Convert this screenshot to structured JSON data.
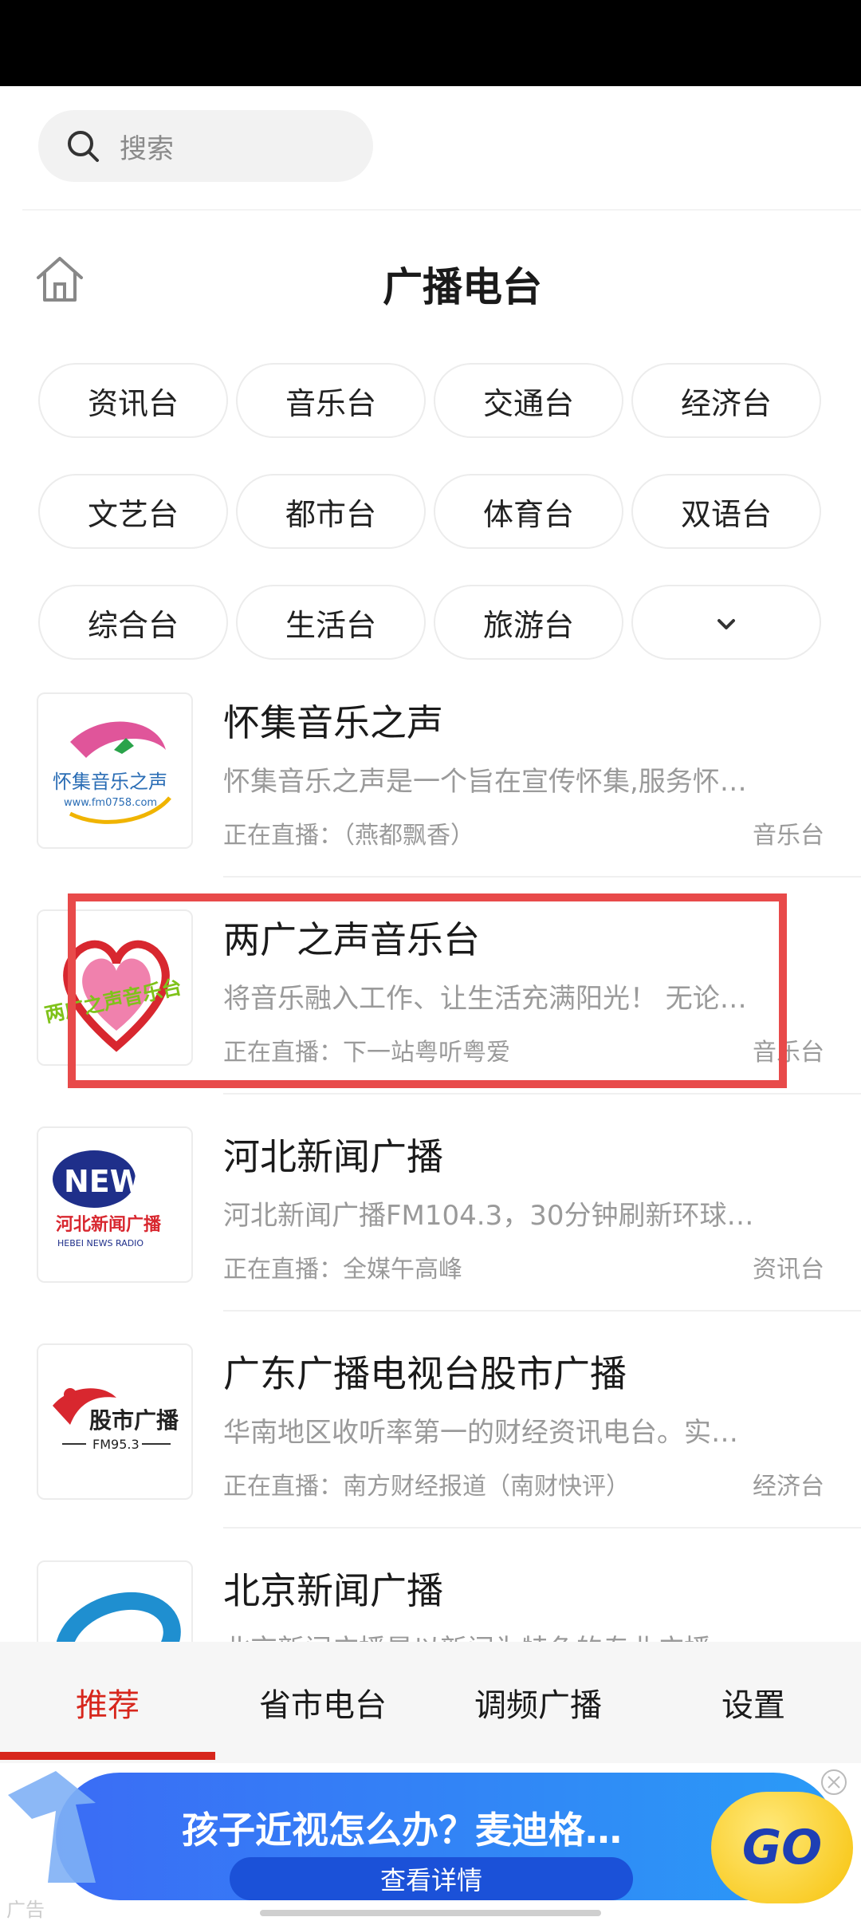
{
  "search": {
    "placeholder": "搜索",
    "icon": "search-icon"
  },
  "header": {
    "title": "广播电台",
    "home_icon": "home-icon"
  },
  "categories": [
    "资讯台",
    "音乐台",
    "交通台",
    "经济台",
    "文艺台",
    "都市台",
    "体育台",
    "双语台",
    "综合台",
    "生活台",
    "旅游台"
  ],
  "more_icon": "chevron-down-icon",
  "stations": [
    {
      "name": "怀集音乐之声",
      "desc": "怀集音乐之声是一个旨在宣传怀集,服务怀…",
      "live": "正在直播：（燕都飘香）",
      "tag": "音乐台",
      "logo_text": "怀集音乐之声",
      "logo_sub": "www.fm0758.com"
    },
    {
      "name": "两广之声音乐台",
      "desc": "将音乐融入工作、让生活充满阳光！ 无论…",
      "live": "正在直播：下一站粤听粤爱",
      "tag": "音乐台",
      "logo_text": "两广之声音乐台"
    },
    {
      "name": "河北新闻广播",
      "desc": "河北新闻广播FM104.3，30分钟刷新环球…",
      "live": "正在直播：全媒午高峰",
      "tag": "资讯台",
      "logo_text": "NEWS",
      "logo_sub": "河北新闻广播",
      "logo_sub2": "HEBEI NEWS RADIO"
    },
    {
      "name": "广东广播电视台股市广播",
      "desc": "华南地区收听率第一的财经资讯电台。实…",
      "live": "正在直播：南方财经报道（南财快评）",
      "tag": "经济台",
      "logo_text": "股市广播",
      "logo_sub": "FM95.3"
    },
    {
      "name": "北京新闻广播",
      "desc": "北京新闻广播是以新闻为特色的专业广播",
      "live": "",
      "tag": ""
    }
  ],
  "tabs": [
    {
      "label": "推荐",
      "active": true
    },
    {
      "label": "省市电台",
      "active": false
    },
    {
      "label": "调频广播",
      "active": false
    },
    {
      "label": "设置",
      "active": false
    }
  ],
  "ad": {
    "text": "孩子近视怎么办？麦迪格…",
    "button": "查看详情",
    "go": "GO",
    "label": "广告"
  },
  "colors": {
    "accent": "#d7261c",
    "highlight": "#e84a4a",
    "ad_blue": "#3b6cf5",
    "go_yellow": "#f7c20a"
  }
}
